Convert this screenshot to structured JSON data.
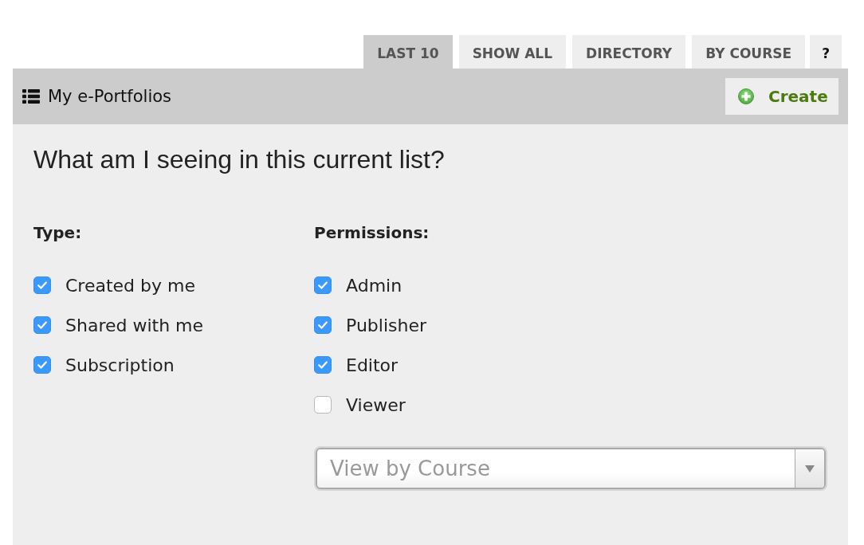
{
  "tabs": [
    {
      "label": "LAST 10",
      "selected": true
    },
    {
      "label": "SHOW ALL",
      "selected": false
    },
    {
      "label": "DIRECTORY",
      "selected": false
    },
    {
      "label": "BY COURSE",
      "selected": false
    },
    {
      "label": "?",
      "selected": false
    }
  ],
  "header": {
    "title": "My e-Portfolios",
    "create_button": "Create"
  },
  "filters": {
    "heading": "What am I seeing in this current list?",
    "groups": [
      {
        "title": "Type:",
        "options": [
          {
            "label": "Created by me",
            "checked": true
          },
          {
            "label": "Shared with me",
            "checked": true
          },
          {
            "label": "Subscription",
            "checked": true
          }
        ]
      },
      {
        "title": "Permissions:",
        "options": [
          {
            "label": "Admin",
            "checked": true
          },
          {
            "label": "Publisher",
            "checked": true
          },
          {
            "label": "Editor",
            "checked": true
          },
          {
            "label": "Viewer",
            "checked": false
          }
        ],
        "dropdown": {
          "placeholder": "View by Course"
        }
      }
    ]
  }
}
